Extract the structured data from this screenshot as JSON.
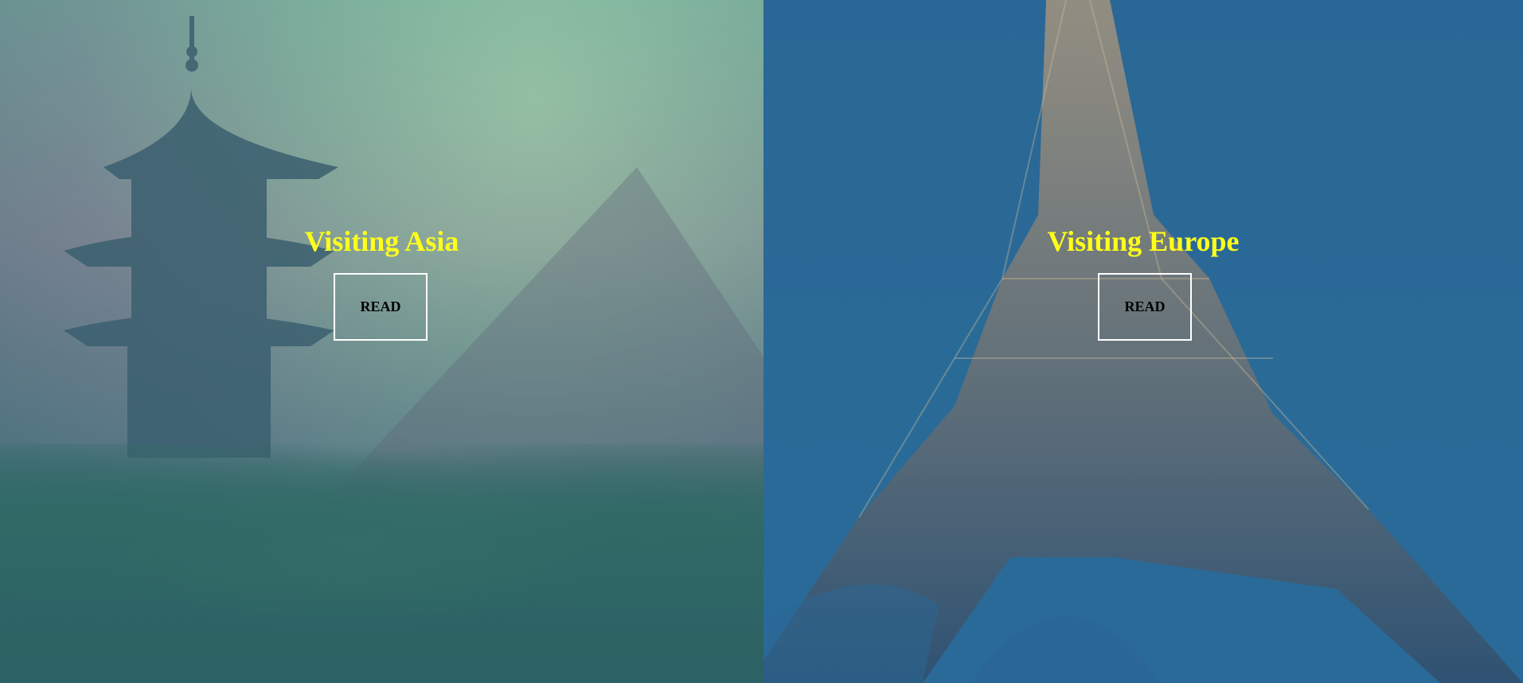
{
  "panels": [
    {
      "id": "asia",
      "heading": "Visiting Asia",
      "button_label": "READ"
    },
    {
      "id": "europe",
      "heading": "Visiting Europe",
      "button_label": "READ"
    }
  ],
  "colors": {
    "heading": "#ffff1a",
    "button_border": "#ffffff",
    "button_text": "#000000",
    "asia_overlay": "#4d7f86",
    "europe_overlay": "#2a6796"
  }
}
